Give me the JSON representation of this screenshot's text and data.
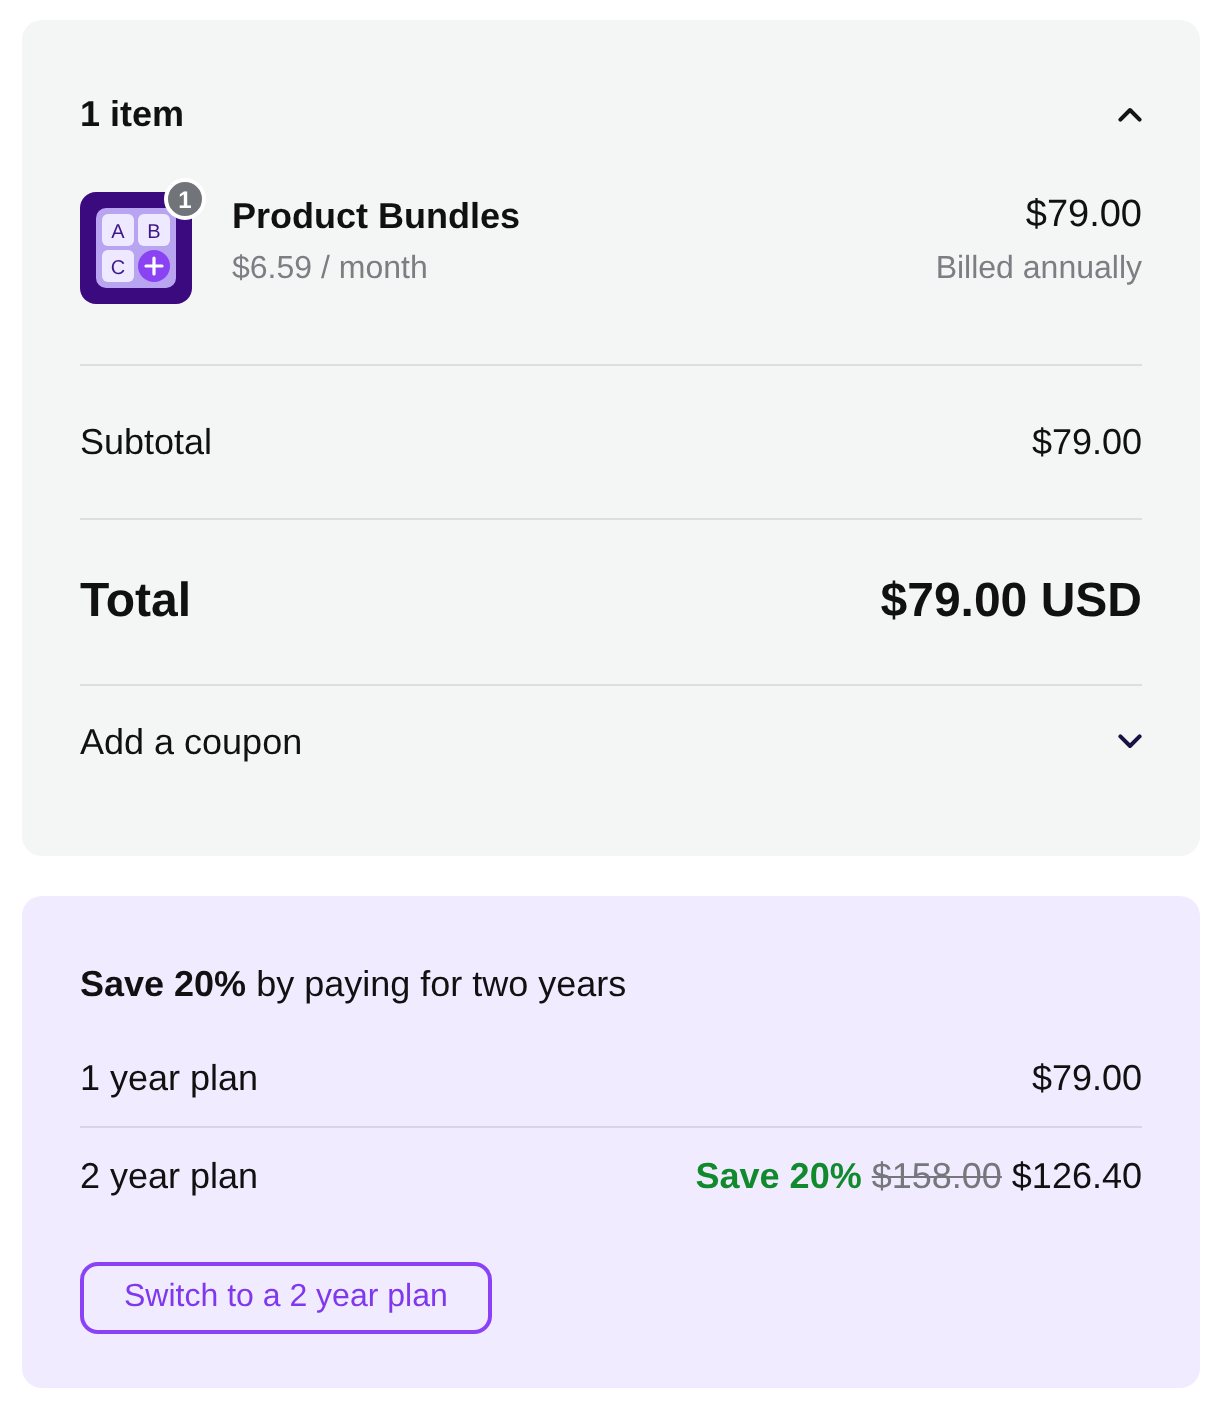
{
  "order_summary": {
    "item_count": "1 item",
    "expanded": true,
    "items": [
      {
        "name": "Product Bundles",
        "quantity": "1",
        "icon_letters": [
          "A",
          "B",
          "C"
        ],
        "unit_price": "$6.59 / month",
        "price": "$79.00",
        "billing": "Billed annually"
      }
    ],
    "subtotal": {
      "label": "Subtotal",
      "value": "$79.00"
    },
    "total": {
      "label": "Total",
      "value": "$79.00 USD"
    },
    "coupon": {
      "label": "Add a coupon",
      "expanded": false
    }
  },
  "upsell": {
    "headline": "**Save 20%** by paying for two years",
    "plans": [
      {
        "label": "1 year plan",
        "price": "$79.00"
      },
      {
        "label": "2 year plan",
        "savings": "Save 20%",
        "original_price": "$158.00",
        "price": "$126.40"
      }
    ],
    "button": "Switch to a 2 year plan"
  }
}
